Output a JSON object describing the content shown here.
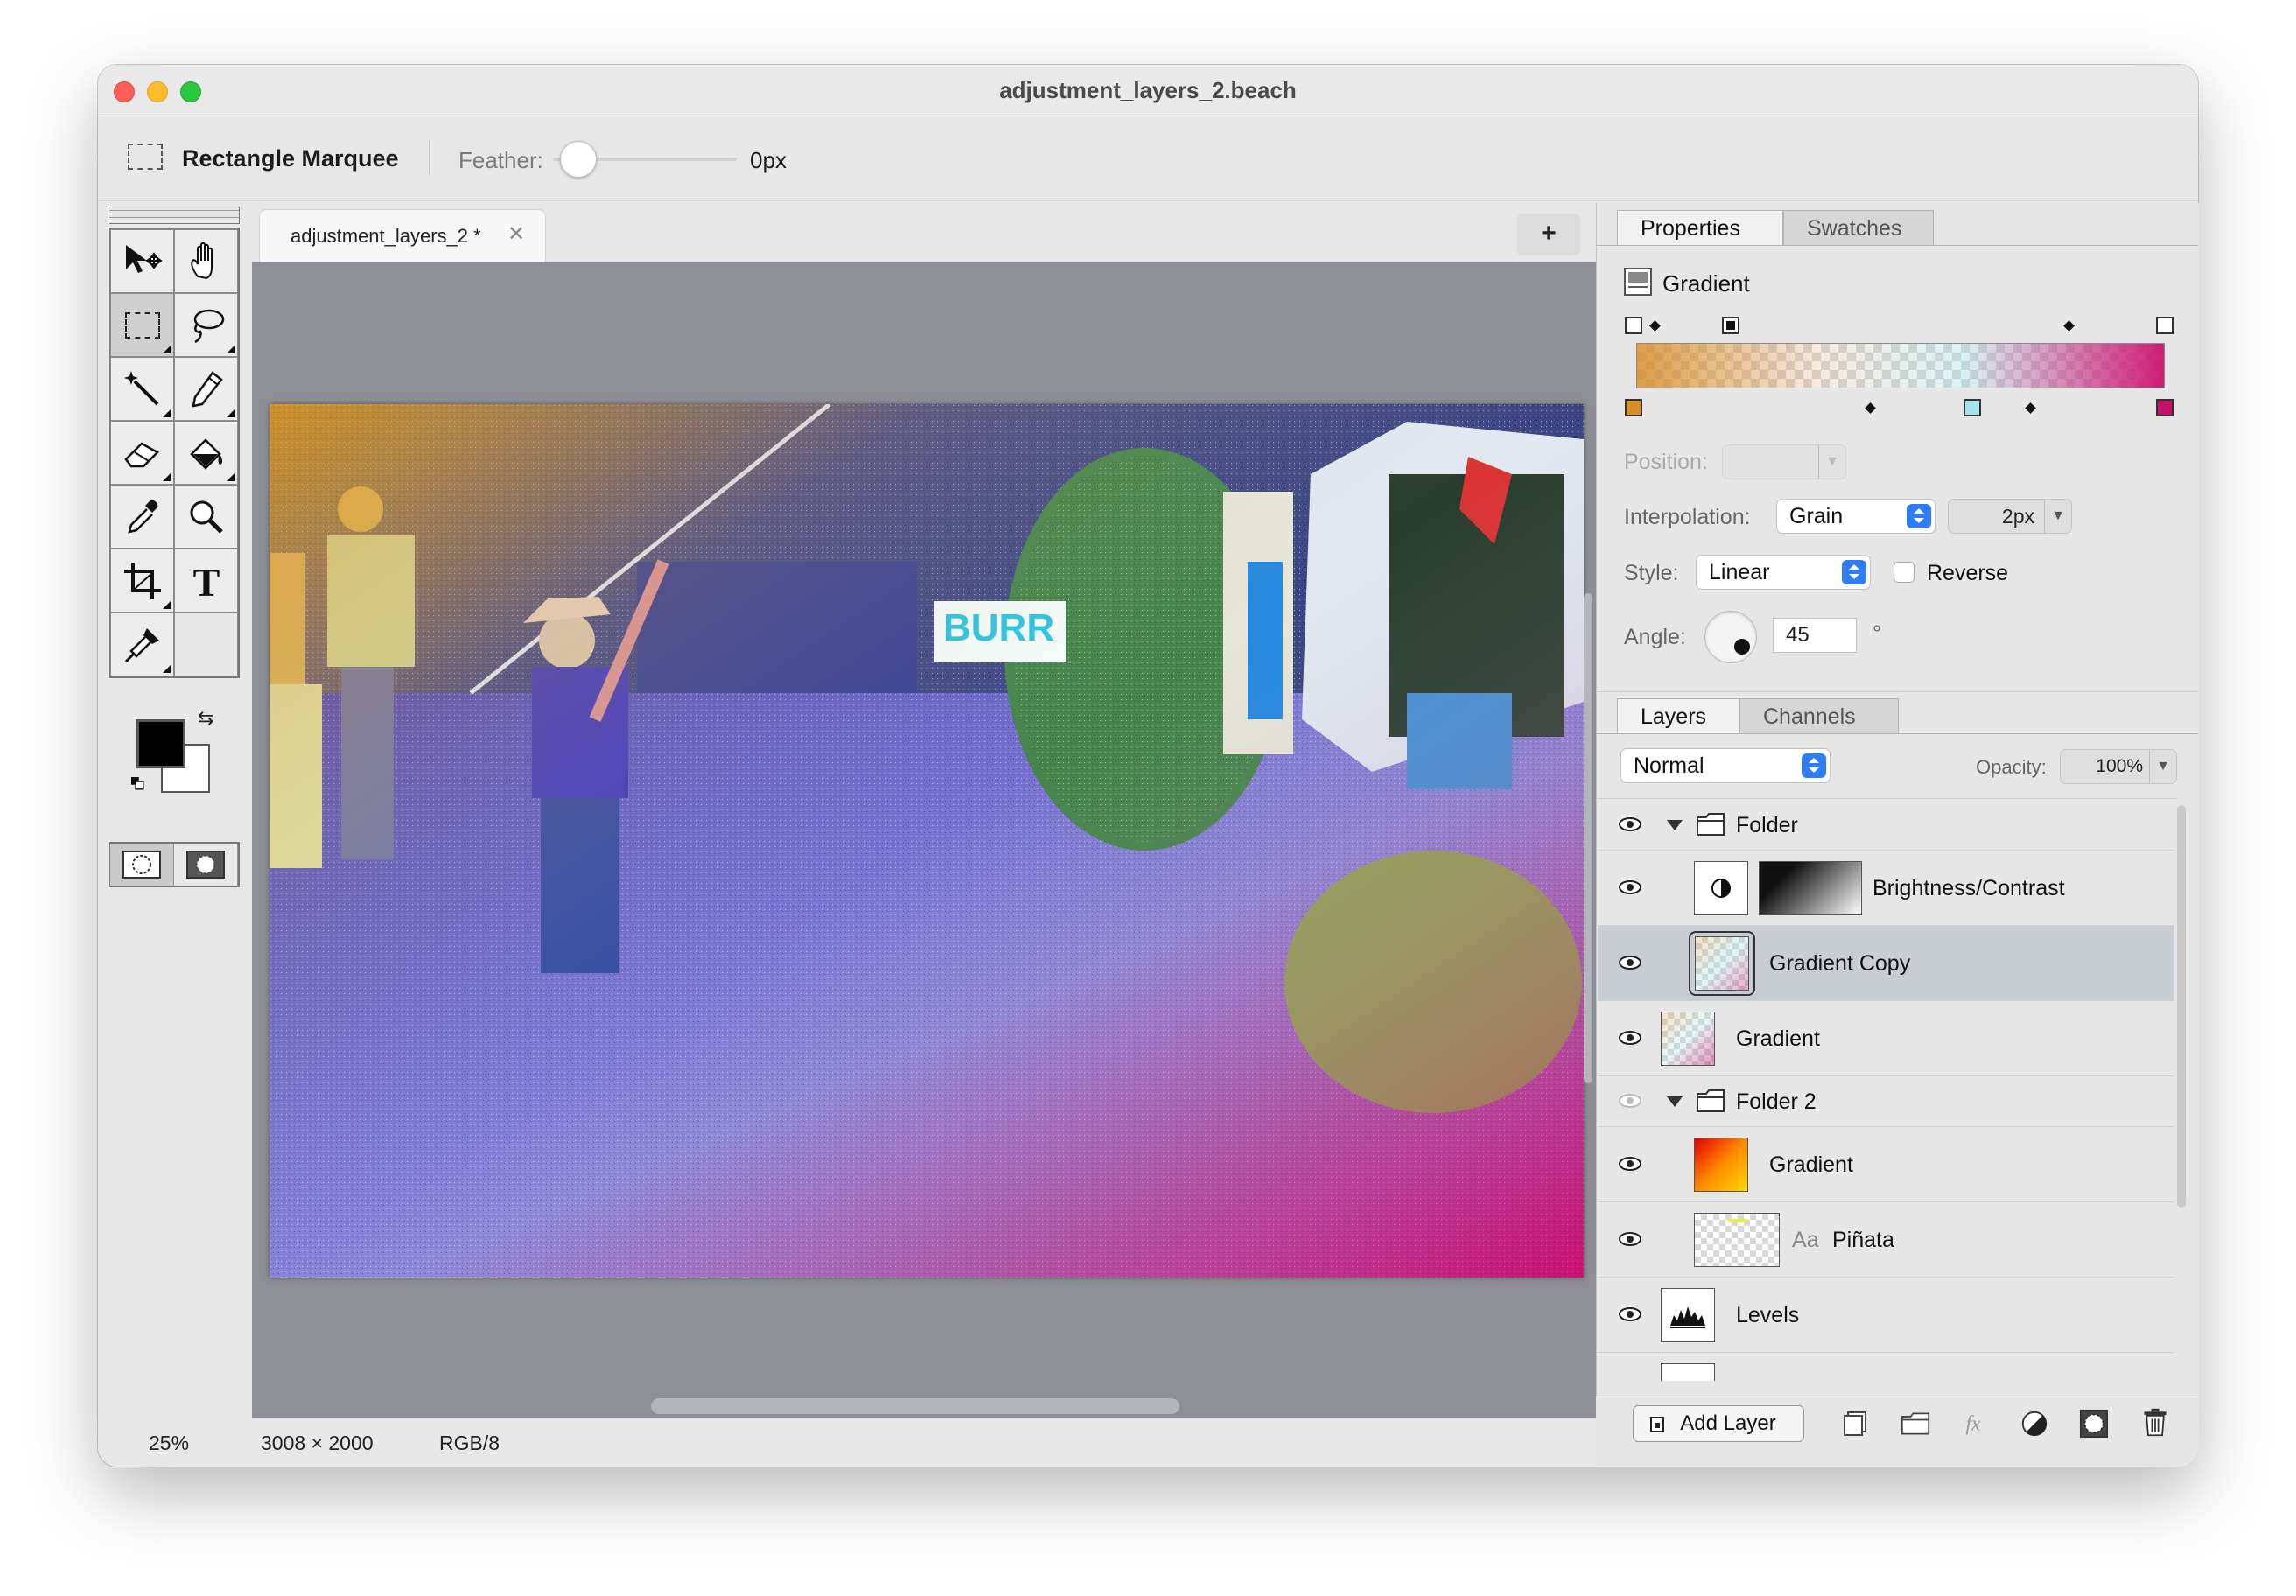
{
  "window": {
    "title": "adjustment_layers_2.beach"
  },
  "options_bar": {
    "tool_icon": "rectangle-marquee-icon",
    "tool_name": "Rectangle Marquee",
    "feather_label": "Feather:",
    "feather_value": "0px",
    "feather_level": 0
  },
  "toolbox": {
    "tools": [
      {
        "name": "move-tool",
        "icon": "move-arrow-icon",
        "glyph": "✥"
      },
      {
        "name": "hand-tool",
        "icon": "hand-icon",
        "glyph": "✋"
      },
      {
        "name": "rectangle-marquee-tool",
        "icon": "marquee-icon",
        "glyph": ""
      },
      {
        "name": "lasso-tool",
        "icon": "lasso-icon",
        "glyph": "ට"
      },
      {
        "name": "magic-wand-tool",
        "icon": "magic-wand-icon",
        "glyph": "⁄"
      },
      {
        "name": "pencil-tool",
        "icon": "pencil-icon",
        "glyph": "✎"
      },
      {
        "name": "eraser-tool",
        "icon": "eraser-icon",
        "glyph": "▱"
      },
      {
        "name": "paint-bucket-tool",
        "icon": "paint-bucket-icon",
        "glyph": "⛽"
      },
      {
        "name": "eyedropper-tool",
        "icon": "eyedropper-icon",
        "glyph": "⁄"
      },
      {
        "name": "zoom-tool",
        "icon": "magnifier-icon",
        "glyph": "🔍"
      },
      {
        "name": "crop-tool",
        "icon": "crop-icon",
        "glyph": "⌗"
      },
      {
        "name": "type-tool",
        "icon": "type-icon",
        "glyph": "T"
      },
      {
        "name": "clone-tool",
        "icon": "clone-stamp-icon",
        "glyph": "✦"
      }
    ],
    "foreground_color": "#000000",
    "background_color": "#ffffff"
  },
  "document": {
    "tab_label": "adjustment_layers_2 *",
    "new_tab_label": "+"
  },
  "status": {
    "zoom": "25%",
    "dimensions": "3008 × 2000",
    "mode": "RGB/8"
  },
  "properties": {
    "tabs": [
      "Properties",
      "Swatches"
    ],
    "layer_type": "Gradient",
    "position_label": "Position:",
    "interpolation_label": "Interpolation:",
    "interpolation_value": "Grain",
    "grain_value": "2px",
    "style_label": "Style:",
    "style_value": "Linear",
    "reverse_label": "Reverse",
    "angle_label": "Angle:",
    "angle_value": "45",
    "angle_unit": "°",
    "color_stops": [
      "#d98c2a",
      "#a6e3e8",
      "#c2126c"
    ]
  },
  "layers": {
    "tabs": [
      "Layers",
      "Channels"
    ],
    "blend_mode": "Normal",
    "opacity_label": "Opacity:",
    "opacity_value": "100%",
    "rows": [
      {
        "name": "Folder",
        "kind": "folder"
      },
      {
        "name": "Brightness/Contrast",
        "kind": "adjustment"
      },
      {
        "name": "Gradient Copy",
        "kind": "gradient",
        "selected": true
      },
      {
        "name": "Gradient",
        "kind": "gradient"
      },
      {
        "name": "Folder 2",
        "kind": "folder",
        "hidden": true
      },
      {
        "name": "Gradient",
        "kind": "gradient-fill"
      },
      {
        "name": "Piñata",
        "kind": "text",
        "prefix": "Aa"
      },
      {
        "name": "Levels",
        "kind": "adjustment"
      }
    ],
    "add_layer_label": "Add Layer"
  }
}
